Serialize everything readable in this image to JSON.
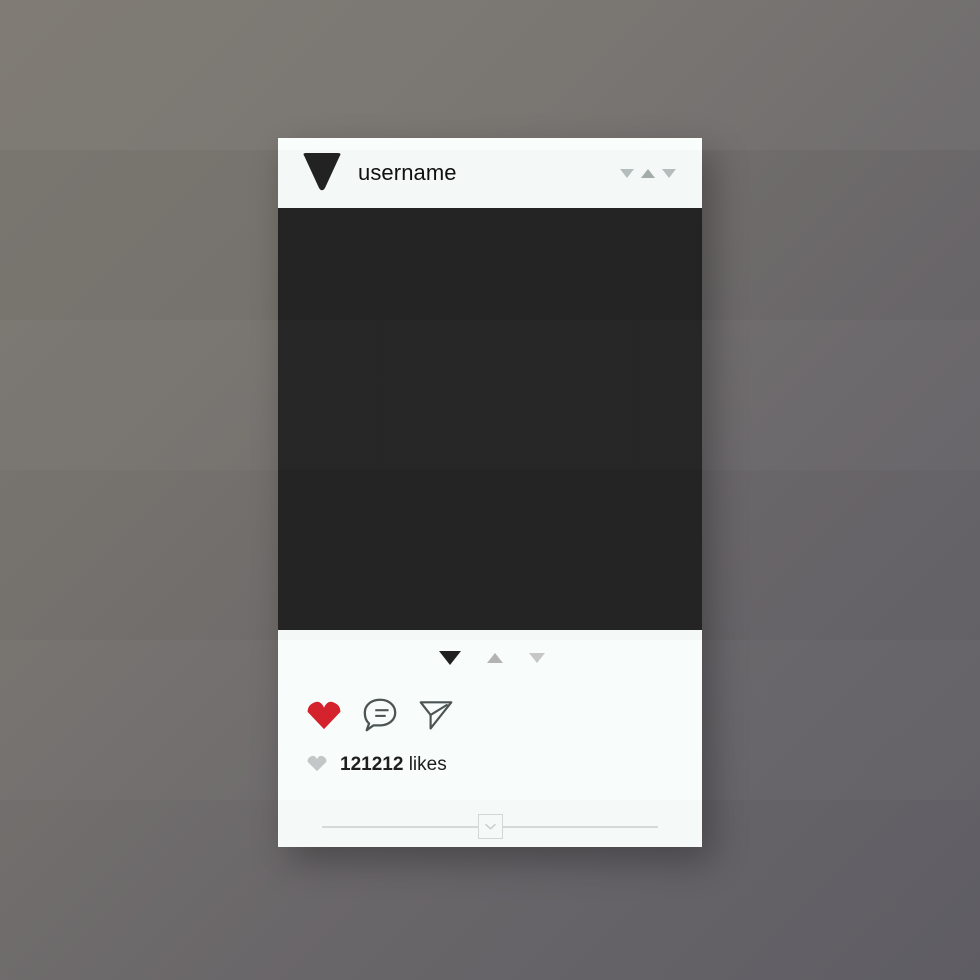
{
  "theme": {
    "card_bg": "#f8fdfb",
    "photo_bg": "#242424",
    "backdrop_from": "#7d7972",
    "backdrop_to": "#605e65",
    "heart_red": "#d3202a",
    "icon_gray": "#4a5252",
    "muted_gray": "#c0c4c4"
  },
  "header": {
    "username": "username",
    "avatar_icon": "triangle-down-avatar",
    "menu_icon": "more-options-triangles"
  },
  "photo": {
    "alt_icon": "photo-placeholder"
  },
  "carousel": {
    "indicators": [
      {
        "icon": "triangle-down",
        "state": "active"
      },
      {
        "icon": "triangle-up",
        "state": "inactive"
      },
      {
        "icon": "triangle-down",
        "state": "inactive"
      }
    ]
  },
  "actions": [
    {
      "icon": "heart-icon",
      "label": "Like",
      "state": "liked"
    },
    {
      "icon": "comment-icon",
      "label": "Comment",
      "state": "default"
    },
    {
      "icon": "share-icon",
      "label": "Share",
      "state": "default"
    }
  ],
  "likes": {
    "icon": "heart-small-icon",
    "count": "121212",
    "label": "likes"
  },
  "footer": {
    "expand_icon": "chevron-down-icon"
  }
}
